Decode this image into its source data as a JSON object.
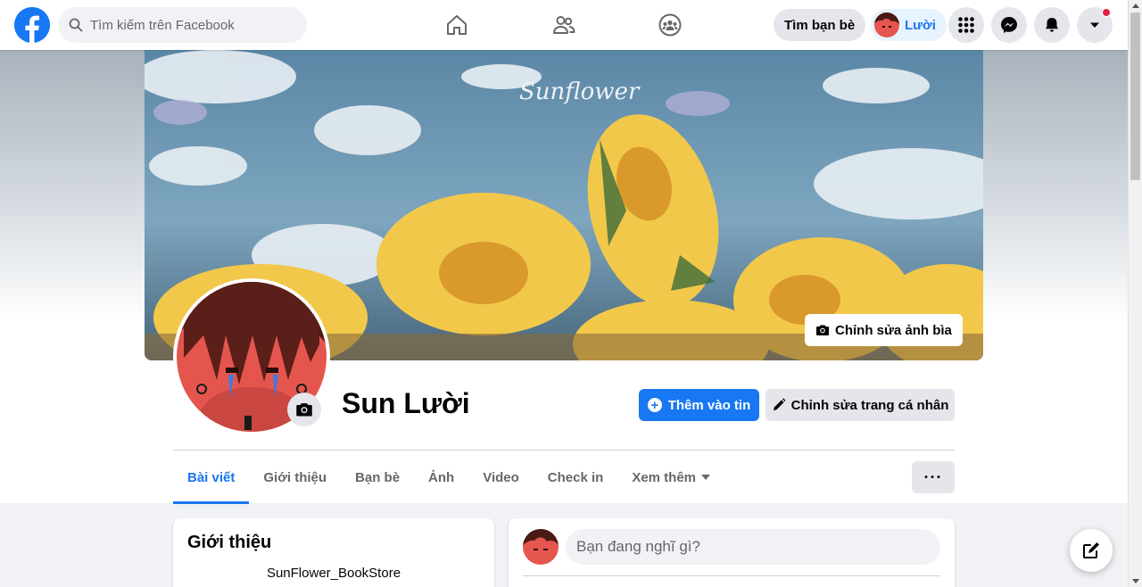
{
  "search": {
    "placeholder": "Tìm kiếm trên Facebook"
  },
  "nav": {
    "center_icons": [
      "home-icon",
      "friends-icon",
      "groups-icon"
    ],
    "find_friends_label": "Tìm bạn bè",
    "profile_chip_name": "Lười",
    "right_icons": [
      "menu-grid-icon",
      "messenger-icon",
      "notifications-icon",
      "account-dropdown-icon"
    ]
  },
  "cover": {
    "edit_label": "Chỉnh sửa ảnh bìa",
    "text": "Sunflower"
  },
  "profile": {
    "name": "Sun Lười",
    "add_story_label": "Thêm vào tin",
    "edit_profile_label": "Chỉnh sửa trang cá nhân"
  },
  "tabs": [
    {
      "label": "Bài viết",
      "active": true
    },
    {
      "label": "Giới thiệu"
    },
    {
      "label": "Bạn bè"
    },
    {
      "label": "Ảnh"
    },
    {
      "label": "Video"
    },
    {
      "label": "Check in"
    },
    {
      "label": "Xem thêm"
    }
  ],
  "more_label": "···",
  "intro": {
    "title": "Giới thiệu",
    "bio": "SunFlower_BookStore"
  },
  "composer": {
    "placeholder": "Bạn đang nghĩ gì?"
  },
  "colors": {
    "brand": "#1877f2",
    "accent_red": "#e41e3f",
    "background": "#f0f2f5"
  }
}
